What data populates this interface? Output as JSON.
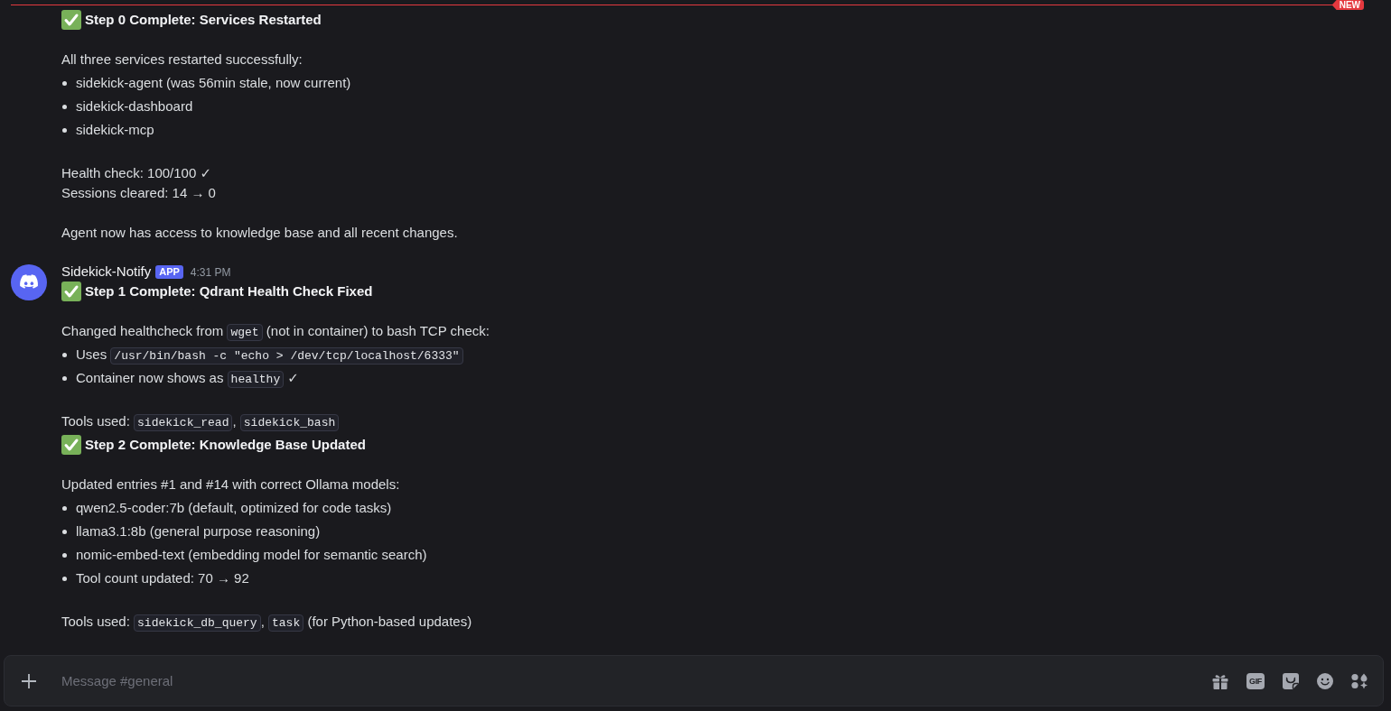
{
  "new_divider": {
    "label": "NEW"
  },
  "messages": [
    {
      "kind": "continuation",
      "blocks": [
        {
          "kind": "heading",
          "text": "Step 0 Complete: Services Restarted"
        },
        {
          "kind": "blank"
        },
        {
          "kind": "line",
          "segments": [
            {
              "kind": "text",
              "text": "All three services restarted successfully:"
            }
          ]
        },
        {
          "kind": "list",
          "items": [
            {
              "segments": [
                {
                  "kind": "text",
                  "text": "sidekick-agent (was 56min stale, now current)"
                }
              ]
            },
            {
              "segments": [
                {
                  "kind": "text",
                  "text": "sidekick-dashboard"
                }
              ]
            },
            {
              "segments": [
                {
                  "kind": "text",
                  "text": "sidekick-mcp"
                }
              ]
            }
          ]
        },
        {
          "kind": "blank"
        },
        {
          "kind": "line",
          "segments": [
            {
              "kind": "text",
              "text": "Health check: 100/100 ✓"
            }
          ]
        },
        {
          "kind": "line",
          "segments": [
            {
              "kind": "text",
              "text": "Sessions cleared: 14 → 0"
            }
          ]
        },
        {
          "kind": "blank"
        },
        {
          "kind": "line",
          "segments": [
            {
              "kind": "text",
              "text": "Agent now has access to knowledge base and all recent changes."
            }
          ]
        }
      ]
    },
    {
      "kind": "group_start",
      "author": "Sidekick-Notify",
      "badge": "APP",
      "time": "4:31 PM",
      "blocks": [
        {
          "kind": "heading",
          "text": "Step 1 Complete: Qdrant Health Check Fixed"
        },
        {
          "kind": "blank"
        },
        {
          "kind": "line",
          "segments": [
            {
              "kind": "text",
              "text": "Changed healthcheck from "
            },
            {
              "kind": "code",
              "text": "wget"
            },
            {
              "kind": "text",
              "text": " (not in container) to bash TCP check:"
            }
          ]
        },
        {
          "kind": "list",
          "items": [
            {
              "segments": [
                {
                  "kind": "text",
                  "text": "Uses "
                },
                {
                  "kind": "code",
                  "text": "/usr/bin/bash -c \"echo > /dev/tcp/localhost/6333\""
                }
              ]
            },
            {
              "segments": [
                {
                  "kind": "text",
                  "text": "Container now shows as "
                },
                {
                  "kind": "code",
                  "text": "healthy"
                },
                {
                  "kind": "text",
                  "text": " ✓"
                }
              ]
            }
          ]
        },
        {
          "kind": "blank"
        },
        {
          "kind": "line",
          "segments": [
            {
              "kind": "text",
              "text": "Tools used: "
            },
            {
              "kind": "code",
              "text": "sidekick_read"
            },
            {
              "kind": "text",
              "text": ", "
            },
            {
              "kind": "code",
              "text": "sidekick_bash"
            }
          ]
        }
      ]
    },
    {
      "kind": "continuation",
      "blocks": [
        {
          "kind": "heading",
          "text": "Step 2 Complete: Knowledge Base Updated"
        },
        {
          "kind": "blank"
        },
        {
          "kind": "line",
          "segments": [
            {
              "kind": "text",
              "text": "Updated entries #1 and #14 with correct Ollama models:"
            }
          ]
        },
        {
          "kind": "list",
          "items": [
            {
              "segments": [
                {
                  "kind": "text",
                  "text": "qwen2.5-coder:7b (default, optimized for code tasks)"
                }
              ]
            },
            {
              "segments": [
                {
                  "kind": "text",
                  "text": "llama3.1:8b (general purpose reasoning)"
                }
              ]
            },
            {
              "segments": [
                {
                  "kind": "text",
                  "text": "nomic-embed-text (embedding model for semantic search)"
                }
              ]
            },
            {
              "segments": [
                {
                  "kind": "text",
                  "text": "Tool count updated: 70 → 92"
                }
              ]
            }
          ]
        },
        {
          "kind": "blank"
        },
        {
          "kind": "line",
          "segments": [
            {
              "kind": "text",
              "text": "Tools used: "
            },
            {
              "kind": "code",
              "text": "sidekick_db_query"
            },
            {
              "kind": "text",
              "text": ", "
            },
            {
              "kind": "code",
              "text": "task"
            },
            {
              "kind": "text",
              "text": " (for Python-based updates)"
            }
          ]
        }
      ]
    }
  ],
  "composer": {
    "placeholder": "Message #general",
    "gif_label": "GIF"
  }
}
